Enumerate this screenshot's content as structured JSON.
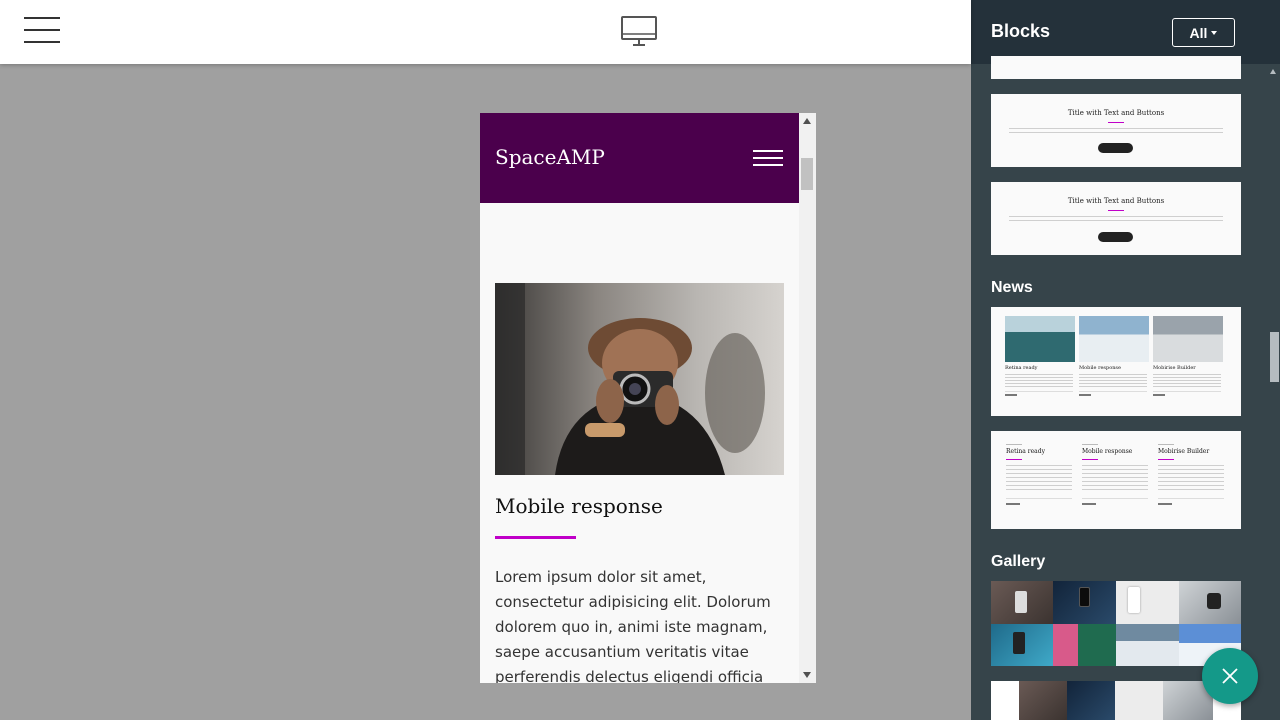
{
  "toolbar": {
    "menu_icon": "hamburger-menu-icon",
    "device_icon": "desktop-monitor-icon"
  },
  "preview": {
    "brand": "SpaceAMP",
    "menu_icon": "hamburger-menu-icon",
    "nav_color": "#4b004c",
    "article": {
      "title": "Mobile response",
      "accent_color": "#c000c8",
      "body": "Lorem ipsum dolor sit amet, consectetur adipisicing elit. Dolorum dolorem quo in, animi iste magnam, saepe accusantium veritatis vitae perferendis delectus eligendi officia"
    }
  },
  "sidebar": {
    "title": "Blocks",
    "filter_label": "All",
    "sections": {
      "text_blocks": {
        "cards": [
          {
            "title": "Title with Text and Buttons"
          },
          {
            "title": "Title with Text and Buttons"
          }
        ]
      },
      "news": {
        "heading": "News",
        "card1": [
          "Retina ready",
          "Mobile response",
          "Mobirise Builder"
        ],
        "card2": [
          "Retina ready",
          "Mobile response",
          "Mobirise Builder"
        ]
      },
      "gallery": {
        "heading": "Gallery"
      }
    }
  },
  "fab": {
    "icon": "close-x-icon",
    "color": "#149989"
  }
}
